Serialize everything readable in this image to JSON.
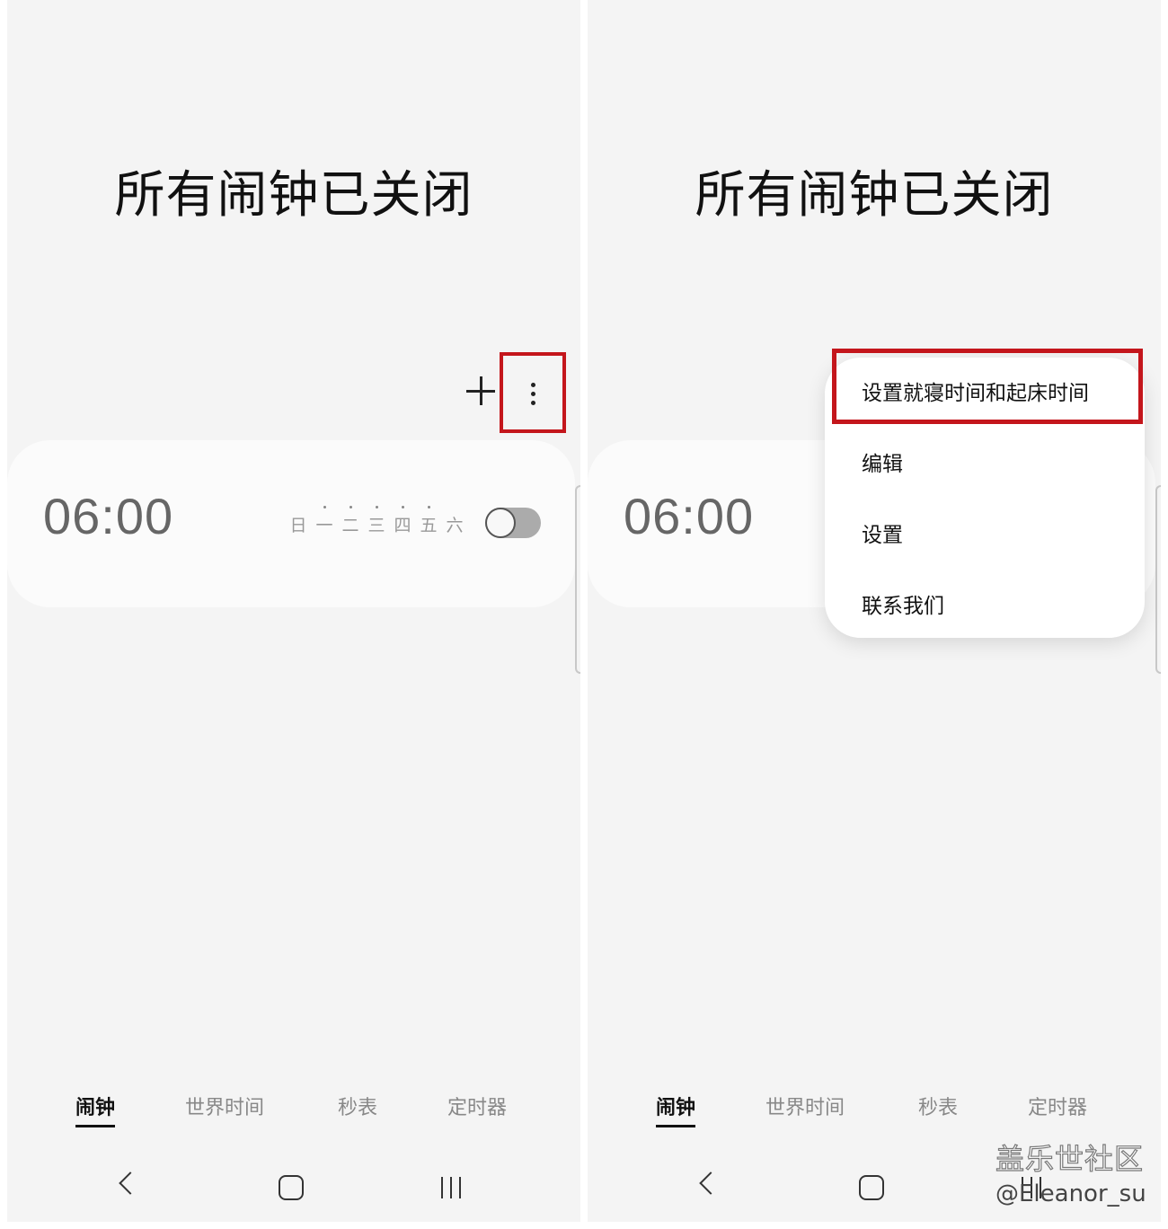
{
  "screens": [
    {
      "title": "所有闹钟已关闭",
      "alarm": {
        "time": "06:00",
        "days": [
          "日",
          "一",
          "二",
          "三",
          "四",
          "五",
          "六"
        ],
        "enabled": false
      },
      "tabs": [
        "闹钟",
        "世界时间",
        "秒表",
        "定时器"
      ],
      "active_tab": "闹钟"
    },
    {
      "title": "所有闹钟已关闭",
      "alarm": {
        "time": "06:00"
      },
      "menu": {
        "items": [
          "设置就寝时间和起床时间",
          "编辑",
          "设置",
          "联系我们"
        ],
        "highlighted": "设置就寝时间和起床时间"
      },
      "tabs": [
        "闹钟",
        "世界时间",
        "秒表",
        "定时器"
      ],
      "active_tab": "闹钟"
    }
  ],
  "highlight_color": "#c4161c",
  "icons": [
    "plus-icon",
    "more-vertical-icon",
    "back-icon",
    "home-icon",
    "recent-apps-icon"
  ],
  "watermark": {
    "line1": "盖乐世社区",
    "line2": "@Eleanor_su"
  }
}
